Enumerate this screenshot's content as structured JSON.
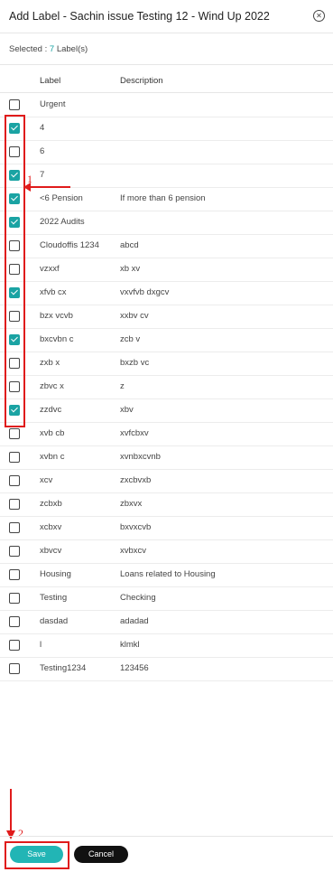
{
  "dialog": {
    "title": "Add Label - Sachin issue Testing 12 - Wind Up 2022",
    "selected_prefix": "Selected : ",
    "selected_count": "7",
    "selected_suffix": " Label(s)"
  },
  "table": {
    "headers": {
      "label": "Label",
      "description": "Description"
    },
    "rows": [
      {
        "label": "Urgent",
        "description": "",
        "checked": false
      },
      {
        "label": "4",
        "description": "",
        "checked": true
      },
      {
        "label": "6",
        "description": "",
        "checked": false
      },
      {
        "label": "7",
        "description": "",
        "checked": true
      },
      {
        "label": "<6 Pension",
        "description": "If more than 6 pension",
        "checked": true
      },
      {
        "label": "2022 Audits",
        "description": "",
        "checked": true
      },
      {
        "label": "Cloudoffis 1234",
        "description": "abcd",
        "checked": false
      },
      {
        "label": "vzxxf",
        "description": "xb xv",
        "checked": false
      },
      {
        "label": "xfvb cx",
        "description": "vxvfvb dxgcv",
        "checked": true
      },
      {
        "label": "bzx vcvb",
        "description": "xxbv cv",
        "checked": false
      },
      {
        "label": "bxcvbn c",
        "description": "zcb v",
        "checked": true
      },
      {
        "label": "zxb x",
        "description": "bxzb vc",
        "checked": false
      },
      {
        "label": "zbvc x",
        "description": "z",
        "checked": false
      },
      {
        "label": "zzdvc",
        "description": "xbv",
        "checked": true
      },
      {
        "label": "xvb cb",
        "description": "xvfcbxv",
        "checked": false
      },
      {
        "label": "xvbn c",
        "description": "xvnbxcvnb",
        "checked": false
      },
      {
        "label": "xcv",
        "description": "zxcbvxb",
        "checked": false
      },
      {
        "label": "zcbxb",
        "description": "zbxvx",
        "checked": false
      },
      {
        "label": "xcbxv",
        "description": "bxvxcvb",
        "checked": false
      },
      {
        "label": "xbvcv",
        "description": "xvbxcv",
        "checked": false
      },
      {
        "label": "Housing",
        "description": "Loans related to Housing",
        "checked": false
      },
      {
        "label": "Testing",
        "description": "Checking",
        "checked": false
      },
      {
        "label": "dasdad",
        "description": "adadad",
        "checked": false
      },
      {
        "label": "l",
        "description": "klmkl",
        "checked": false
      },
      {
        "label": "Testing1234",
        "description": "123456",
        "checked": false
      }
    ]
  },
  "footer": {
    "save_label": "Save",
    "cancel_label": "Cancel"
  },
  "annotations": {
    "marker1": "1",
    "marker2": "2"
  },
  "colors": {
    "accent": "#1aa3a3",
    "annotation": "#e01b1b",
    "cancel": "#111111"
  }
}
